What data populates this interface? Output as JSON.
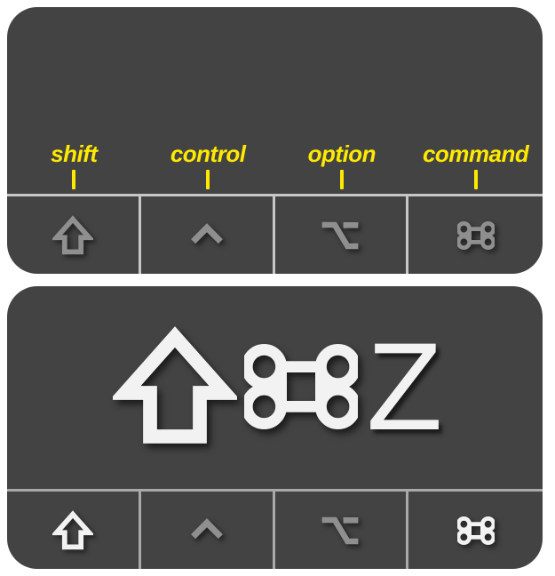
{
  "labels": {
    "shift": "shift",
    "control": "control",
    "option": "option",
    "command": "command"
  },
  "shortcut": {
    "letter": "Z",
    "components": [
      "shift",
      "command",
      "Z"
    ]
  },
  "modifier_keys": [
    {
      "name": "shift",
      "symbol": "⇧"
    },
    {
      "name": "control",
      "symbol": "⌃"
    },
    {
      "name": "option",
      "symbol": "⌥"
    },
    {
      "name": "command",
      "symbol": "⌘"
    }
  ],
  "colors": {
    "panel_bg": "#434343",
    "label_color": "#ffe900",
    "glyph_light": "#f2f2f2",
    "glyph_dim": "#8f8f8f",
    "grid_line": "#a9a9a9"
  }
}
